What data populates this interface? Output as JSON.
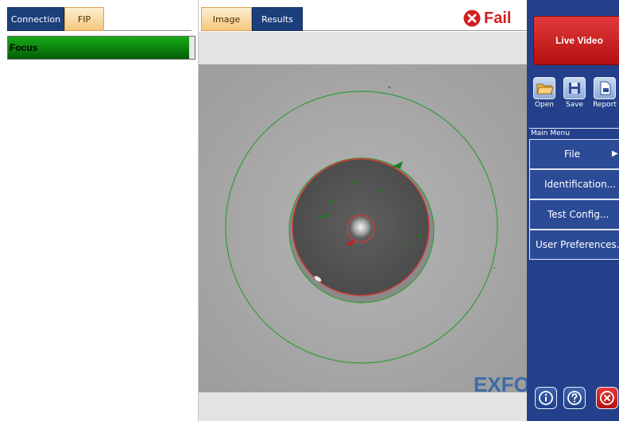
{
  "left_tabs": {
    "connection": "Connection",
    "fip": "FIP",
    "active": "FIP"
  },
  "focus": {
    "label": "Focus",
    "level": 0.97,
    "color": "#0d8a0f"
  },
  "center_tabs": {
    "image": "Image",
    "results": "Results",
    "active": "Image"
  },
  "status": {
    "text": "Fail",
    "icon": "close-circle-icon",
    "color": "#d11f1f"
  },
  "watermark": "EXFO",
  "live_video": {
    "label": "Live Video"
  },
  "toolbar": {
    "open": "Open",
    "save": "Save",
    "report": "Report"
  },
  "main_menu": {
    "header": "Main Menu",
    "file": "File",
    "file_arrow": "▶",
    "identification": "Identification...",
    "test_config": "Test Config...",
    "user_preferences": "User Preferences..."
  },
  "bottom_buttons": {
    "info_icon": "info-icon",
    "help_icon": "help-icon",
    "exit_icon": "close-circle-icon"
  },
  "colors": {
    "panel_blue": "#24408a",
    "tab_active": "#f5c77e",
    "tab_inactive": "#1b3f7a",
    "fail_red": "#d11f1f",
    "zone_green": "#2f9e36",
    "core_red": "#d63a3a"
  }
}
